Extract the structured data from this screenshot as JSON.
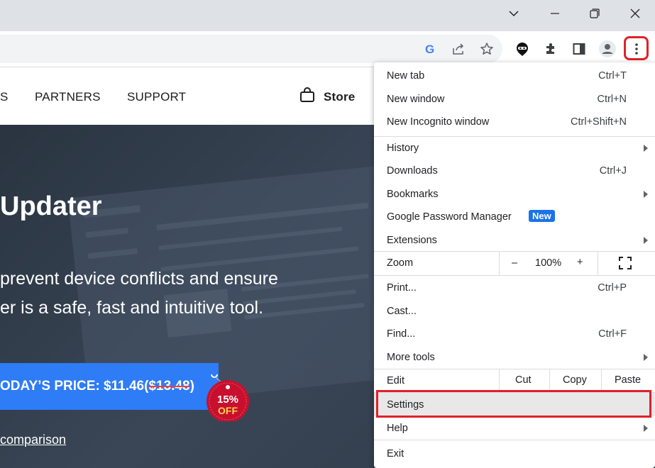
{
  "window": {
    "controls": [
      "chevron-down",
      "minimize",
      "restore",
      "close"
    ]
  },
  "toolbar": {
    "icons": [
      "google-lens-icon",
      "share-icon",
      "bookmark-star-icon",
      "extension-ninja-icon",
      "extensions-puzzle-icon",
      "side-panel-icon",
      "profile-icon",
      "kebab-menu-icon"
    ]
  },
  "site": {
    "nav": {
      "partial_left": "S",
      "partners": "PARTNERS",
      "support": "SUPPORT",
      "store": "Store"
    },
    "hero": {
      "title": "Updater",
      "desc_line1": "prevent device conflicts and ensure",
      "desc_line2": "er is a safe, fast and intuitive tool.",
      "price_prefix": "ODAY’S PRICE: $11.46(",
      "price_old": "$13.48",
      "price_suffix": ")",
      "badge_pct": "15%",
      "badge_off": "OFF",
      "compare_link": "comparison"
    }
  },
  "menu": {
    "new_tab": {
      "label": "New tab",
      "shortcut": "Ctrl+T"
    },
    "new_window": {
      "label": "New window",
      "shortcut": "Ctrl+N"
    },
    "new_incognito": {
      "label": "New Incognito window",
      "shortcut": "Ctrl+Shift+N"
    },
    "history": {
      "label": "History"
    },
    "downloads": {
      "label": "Downloads",
      "shortcut": "Ctrl+J"
    },
    "bookmarks": {
      "label": "Bookmarks"
    },
    "password_manager": {
      "label": "Google Password Manager",
      "badge": "New"
    },
    "extensions": {
      "label": "Extensions"
    },
    "zoom": {
      "label": "Zoom",
      "minus": "–",
      "level": "100%",
      "plus": "+"
    },
    "print": {
      "label": "Print...",
      "shortcut": "Ctrl+P"
    },
    "cast": {
      "label": "Cast..."
    },
    "find": {
      "label": "Find...",
      "shortcut": "Ctrl+F"
    },
    "more_tools": {
      "label": "More tools"
    },
    "edit": {
      "label": "Edit",
      "cut": "Cut",
      "copy": "Copy",
      "paste": "Paste"
    },
    "settings": {
      "label": "Settings"
    },
    "help": {
      "label": "Help"
    },
    "exit": {
      "label": "Exit"
    }
  },
  "colors": {
    "highlight": "#e0202a",
    "accent": "#1a73e8",
    "cta": "#2e7cf6"
  }
}
